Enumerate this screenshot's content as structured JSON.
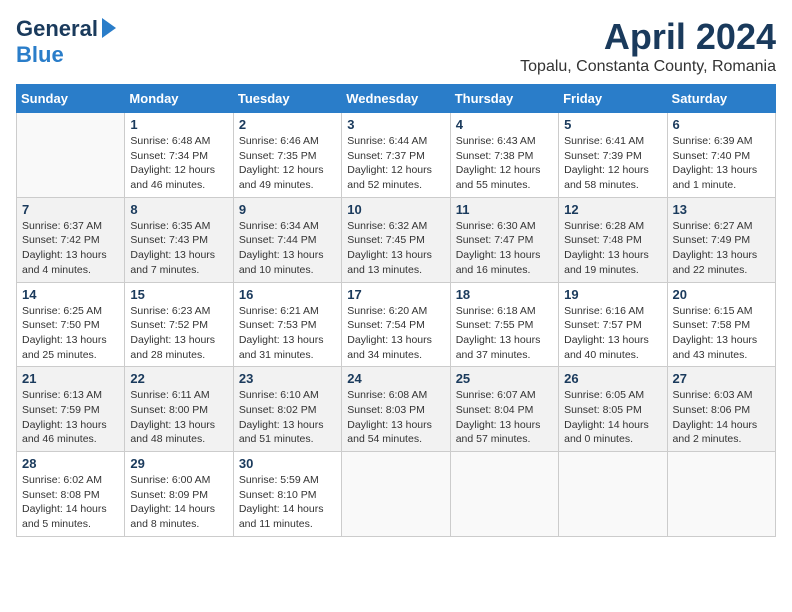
{
  "header": {
    "logo": {
      "general": "General",
      "blue": "Blue"
    },
    "title": "April 2024",
    "subtitle": "Topalu, Constanta County, Romania"
  },
  "days_of_week": [
    "Sunday",
    "Monday",
    "Tuesday",
    "Wednesday",
    "Thursday",
    "Friday",
    "Saturday"
  ],
  "weeks": [
    [
      {
        "day": "",
        "info": ""
      },
      {
        "day": "1",
        "info": "Sunrise: 6:48 AM\nSunset: 7:34 PM\nDaylight: 12 hours\nand 46 minutes."
      },
      {
        "day": "2",
        "info": "Sunrise: 6:46 AM\nSunset: 7:35 PM\nDaylight: 12 hours\nand 49 minutes."
      },
      {
        "day": "3",
        "info": "Sunrise: 6:44 AM\nSunset: 7:37 PM\nDaylight: 12 hours\nand 52 minutes."
      },
      {
        "day": "4",
        "info": "Sunrise: 6:43 AM\nSunset: 7:38 PM\nDaylight: 12 hours\nand 55 minutes."
      },
      {
        "day": "5",
        "info": "Sunrise: 6:41 AM\nSunset: 7:39 PM\nDaylight: 12 hours\nand 58 minutes."
      },
      {
        "day": "6",
        "info": "Sunrise: 6:39 AM\nSunset: 7:40 PM\nDaylight: 13 hours\nand 1 minute."
      }
    ],
    [
      {
        "day": "7",
        "info": "Sunrise: 6:37 AM\nSunset: 7:42 PM\nDaylight: 13 hours\nand 4 minutes."
      },
      {
        "day": "8",
        "info": "Sunrise: 6:35 AM\nSunset: 7:43 PM\nDaylight: 13 hours\nand 7 minutes."
      },
      {
        "day": "9",
        "info": "Sunrise: 6:34 AM\nSunset: 7:44 PM\nDaylight: 13 hours\nand 10 minutes."
      },
      {
        "day": "10",
        "info": "Sunrise: 6:32 AM\nSunset: 7:45 PM\nDaylight: 13 hours\nand 13 minutes."
      },
      {
        "day": "11",
        "info": "Sunrise: 6:30 AM\nSunset: 7:47 PM\nDaylight: 13 hours\nand 16 minutes."
      },
      {
        "day": "12",
        "info": "Sunrise: 6:28 AM\nSunset: 7:48 PM\nDaylight: 13 hours\nand 19 minutes."
      },
      {
        "day": "13",
        "info": "Sunrise: 6:27 AM\nSunset: 7:49 PM\nDaylight: 13 hours\nand 22 minutes."
      }
    ],
    [
      {
        "day": "14",
        "info": "Sunrise: 6:25 AM\nSunset: 7:50 PM\nDaylight: 13 hours\nand 25 minutes."
      },
      {
        "day": "15",
        "info": "Sunrise: 6:23 AM\nSunset: 7:52 PM\nDaylight: 13 hours\nand 28 minutes."
      },
      {
        "day": "16",
        "info": "Sunrise: 6:21 AM\nSunset: 7:53 PM\nDaylight: 13 hours\nand 31 minutes."
      },
      {
        "day": "17",
        "info": "Sunrise: 6:20 AM\nSunset: 7:54 PM\nDaylight: 13 hours\nand 34 minutes."
      },
      {
        "day": "18",
        "info": "Sunrise: 6:18 AM\nSunset: 7:55 PM\nDaylight: 13 hours\nand 37 minutes."
      },
      {
        "day": "19",
        "info": "Sunrise: 6:16 AM\nSunset: 7:57 PM\nDaylight: 13 hours\nand 40 minutes."
      },
      {
        "day": "20",
        "info": "Sunrise: 6:15 AM\nSunset: 7:58 PM\nDaylight: 13 hours\nand 43 minutes."
      }
    ],
    [
      {
        "day": "21",
        "info": "Sunrise: 6:13 AM\nSunset: 7:59 PM\nDaylight: 13 hours\nand 46 minutes."
      },
      {
        "day": "22",
        "info": "Sunrise: 6:11 AM\nSunset: 8:00 PM\nDaylight: 13 hours\nand 48 minutes."
      },
      {
        "day": "23",
        "info": "Sunrise: 6:10 AM\nSunset: 8:02 PM\nDaylight: 13 hours\nand 51 minutes."
      },
      {
        "day": "24",
        "info": "Sunrise: 6:08 AM\nSunset: 8:03 PM\nDaylight: 13 hours\nand 54 minutes."
      },
      {
        "day": "25",
        "info": "Sunrise: 6:07 AM\nSunset: 8:04 PM\nDaylight: 13 hours\nand 57 minutes."
      },
      {
        "day": "26",
        "info": "Sunrise: 6:05 AM\nSunset: 8:05 PM\nDaylight: 14 hours\nand 0 minutes."
      },
      {
        "day": "27",
        "info": "Sunrise: 6:03 AM\nSunset: 8:06 PM\nDaylight: 14 hours\nand 2 minutes."
      }
    ],
    [
      {
        "day": "28",
        "info": "Sunrise: 6:02 AM\nSunset: 8:08 PM\nDaylight: 14 hours\nand 5 minutes."
      },
      {
        "day": "29",
        "info": "Sunrise: 6:00 AM\nSunset: 8:09 PM\nDaylight: 14 hours\nand 8 minutes."
      },
      {
        "day": "30",
        "info": "Sunrise: 5:59 AM\nSunset: 8:10 PM\nDaylight: 14 hours\nand 11 minutes."
      },
      {
        "day": "",
        "info": ""
      },
      {
        "day": "",
        "info": ""
      },
      {
        "day": "",
        "info": ""
      },
      {
        "day": "",
        "info": ""
      }
    ]
  ]
}
